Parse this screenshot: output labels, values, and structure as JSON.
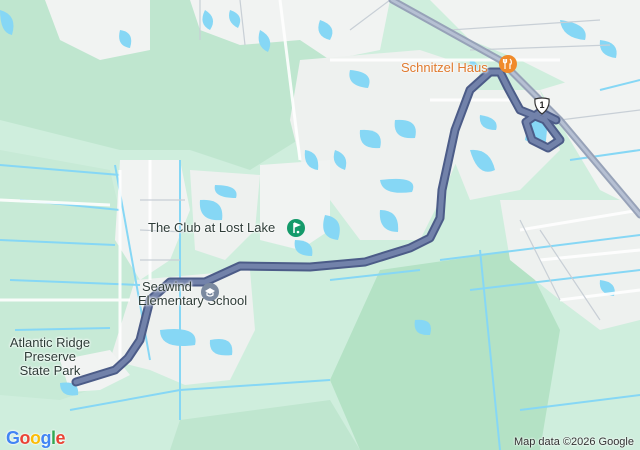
{
  "map": {
    "labels": {
      "club": "The Club at Lost Lake",
      "school_line1": "Seawind",
      "school_line2": "Elementary School",
      "park_line1": "Atlantic Ridge",
      "park_line2": "Preserve",
      "park_line3": "State Park",
      "restaurant": "Schnitzel Haus"
    },
    "shield": "1",
    "icons": {
      "golf": "golf-icon",
      "school": "school-icon",
      "restaurant": "restaurant-icon",
      "highway": "us-highway-shield-icon"
    },
    "colors": {
      "land": "#cfeedd",
      "park": "#a8dcbb",
      "water": "#7fd3f3",
      "developed": "#f2f3f2",
      "route": "#6878a0",
      "route_outline": "#4a5a86",
      "poi_green": "#149a6a",
      "poi_gray": "#7b8aa0",
      "poi_orange": "#f08a2a"
    }
  },
  "footer": {
    "logo": "Google",
    "attribution": "Map data ©2026 Google"
  }
}
